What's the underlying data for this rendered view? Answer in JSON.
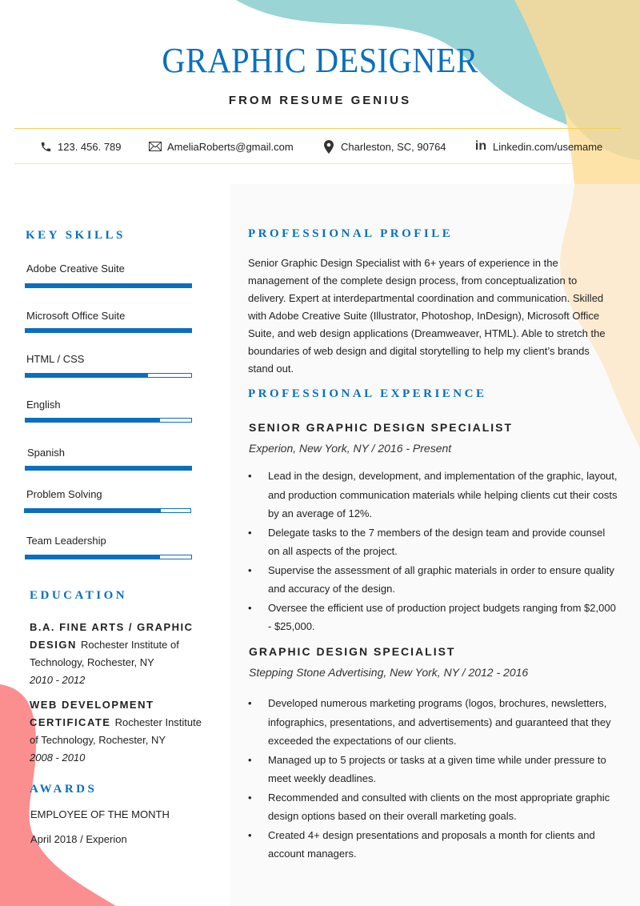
{
  "header": {
    "title": "GRAPHIC DESIGNER",
    "subtitle": "FROM RESUME GENIUS"
  },
  "contact": {
    "phone": {
      "icon": "phone-icon",
      "text": "123. 456. 789"
    },
    "email": {
      "icon": "envelope-icon",
      "text": "AmeliaRoberts@gmail.com"
    },
    "location": {
      "icon": "map-pin-icon",
      "text": "Charleston,  SC,  90764"
    },
    "linkedin": {
      "icon": "linkedin-icon",
      "glyph": "in",
      "text": "Linkedin.com/usemame"
    }
  },
  "colors": {
    "accent": "#0a6fbd",
    "teal_blob": "#9ad4d4",
    "tan_blob": "#ebd9a1",
    "peach_blob": "#fde3a7",
    "light_peach_blob": "#fcebd1",
    "coral_blob": "#fb8f8f",
    "rule": "#f4cf58"
  },
  "skills": {
    "heading": "KEY SKILLS",
    "items": [
      {
        "label": "Adobe Creative Suite",
        "level": 1.0
      },
      {
        "label": "Microsoft Office Suite",
        "level": 1.0
      },
      {
        "label": "HTML / CSS",
        "level": 0.74
      },
      {
        "label": "English",
        "level": 0.81
      },
      {
        "label": "Spanish",
        "level": 1.0
      },
      {
        "label": "Problem Solving",
        "level": 0.82
      },
      {
        "label": "Team Leadership",
        "level": 0.81
      }
    ]
  },
  "education": {
    "heading": "EDUCATION",
    "items": [
      {
        "degree": "B.A. FINE ARTS / GRAPHIC DESIGN",
        "school": "Rochester Institute of Technology, Rochester, NY",
        "dates": "2010 - 2012"
      },
      {
        "degree": "WEB DEVELOPMENT CERTIFICATE",
        "school": "Rochester Institute of Technology, Rochester, NY",
        "dates": "2008 - 2010"
      }
    ]
  },
  "awards": {
    "heading": "AWARDS",
    "title": "EMPLOYEE OF THE MONTH",
    "detail": "April 2018 / Experion"
  },
  "profile": {
    "heading": "PROFESSIONAL PROFILE",
    "text": "Senior Graphic Design Specialist with 6+ years of experience in the management of the complete design process, from conceptualization to delivery. Expert at interdepartmental coordination and communication. Skilled with Adobe Creative Suite (Illustrator, Photoshop, InDesign), Microsoft Office Suite, and web design applications (Dreamweaver, HTML). Able to stretch the boundaries of web design and digital storytelling to help my client’s brands stand out."
  },
  "experience": {
    "heading": "PROFESSIONAL EXPERIENCE",
    "jobs": [
      {
        "title": "SENIOR GRAPHIC DESIGN SPECIALIST",
        "subtitle": "Experion, New York, NY / 2016 - Present",
        "bullets": [
          "Lead in the design, development, and implementation of the graphic, layout, and production communication materials while helping clients cut their costs by an average of 12%.",
          "Delegate tasks to the 7 members of the design team and provide counsel on all aspects of the project.",
          "Supervise the assessment of all graphic materials in order to ensure quality and accuracy of the design.",
          "Oversee the efficient use of production project budgets ranging from $2,000 - $25,000."
        ]
      },
      {
        "title": "GRAPHIC DESIGN SPECIALIST",
        "subtitle": "Stepping Stone Advertising, New York, NY / 2012 - 2016",
        "bullets": [
          "Developed numerous marketing programs (logos, brochures, newsletters, infographics, presentations, and advertisements) and guaranteed that they exceeded the expectations of our clients.",
          "Managed up to 5 projects or tasks at a given time while under pressure to meet weekly deadlines.",
          "Recommended and consulted with clients on the most appropriate graphic design options based on their overall marketing goals.",
          "Created 4+ design presentations and proposals a month for clients and account managers."
        ]
      }
    ]
  }
}
